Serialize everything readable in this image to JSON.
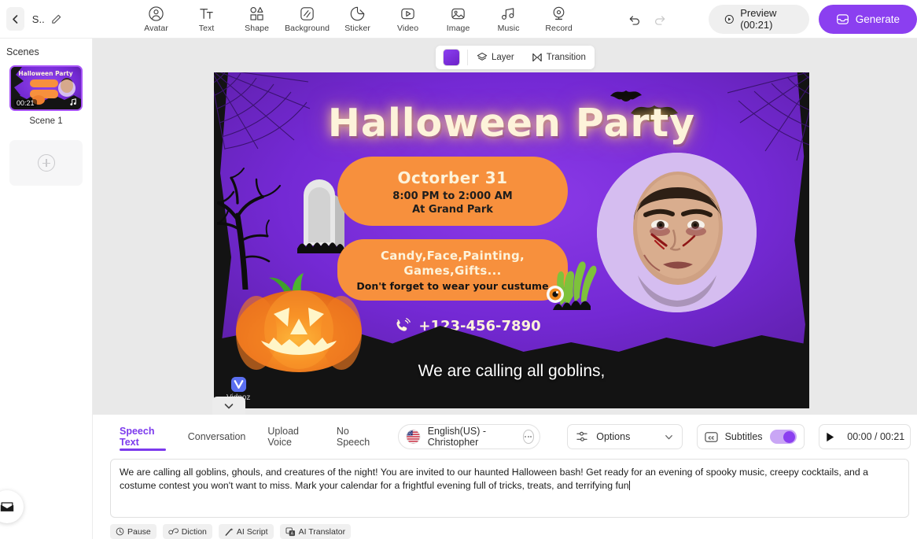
{
  "topbar": {
    "project_title": "S...",
    "back_icon": "chevron-left-icon",
    "edit_icon": "pencil-icon",
    "tools": [
      {
        "label": "Avatar",
        "icon": "avatar-icon"
      },
      {
        "label": "Text",
        "icon": "text-icon"
      },
      {
        "label": "Shape",
        "icon": "shape-icon"
      },
      {
        "label": "Background",
        "icon": "background-icon"
      },
      {
        "label": "Sticker",
        "icon": "sticker-icon"
      },
      {
        "label": "Video",
        "icon": "video-icon"
      },
      {
        "label": "Image",
        "icon": "image-icon"
      },
      {
        "label": "Music",
        "icon": "music-icon"
      },
      {
        "label": "Record",
        "icon": "record-icon"
      }
    ],
    "undo_icon": "undo-icon",
    "redo_icon": "redo-icon",
    "preview_label": "Preview (00:21)",
    "generate_label": "Generate",
    "accent_color": "#8b3ff0"
  },
  "sidebar": {
    "heading": "Scenes",
    "scene": {
      "label": "Scene 1",
      "duration": "00:21",
      "thumb_title": "Halloween Party",
      "music_icon": "music-note-icon"
    },
    "add_scene_icon": "plus-circle-icon",
    "feedback_icon": "envelope-icon"
  },
  "canvas": {
    "layer_bar": {
      "color_swatch": "#7a2fd8",
      "layer_label": "Layer",
      "layer_icon": "layers-icon",
      "transition_label": "Transition",
      "transition_icon": "transition-icon"
    },
    "poster": {
      "title": "Halloween Party",
      "date": "Octorber 31",
      "time_line1": "8:00 PM to 2:000 AM",
      "time_line2": "At Grand Park",
      "features_line1": "Candy,Face,Painting,",
      "features_line2": "Games,Gifts...",
      "note": "Don't forget to wear your custume",
      "phone": "+123-456-7890",
      "phone_icon": "phone-call-icon",
      "watermark": "Vidnoz",
      "watermark_icon": "vidnoz-logo-icon",
      "bg_purple": "#7429d4",
      "accent_orange": "#f7903d",
      "title_cream": "#fdf3da"
    },
    "subtitle_text": "We are calling all goblins,",
    "collapse_icon": "chevron-down-icon"
  },
  "bottom": {
    "tabs": [
      {
        "label": "Speech Text",
        "active": true
      },
      {
        "label": "Conversation",
        "active": false
      },
      {
        "label": "Upload Voice",
        "active": false
      },
      {
        "label": "No Speech",
        "active": false
      }
    ],
    "voice": {
      "flag_icon": "us-flag-icon",
      "name": "English(US) - Christopher",
      "more_icon": "more-options-icon"
    },
    "options": {
      "label": "Options",
      "icon": "sliders-icon",
      "chevron": "chevron-down-icon"
    },
    "subtitles": {
      "label": "Subtitles",
      "icon": "cc-icon",
      "enabled": true,
      "toggle_color": "#8b3ff0"
    },
    "player": {
      "icon": "play-icon",
      "time": "00:00 / 00:21"
    },
    "script": "We are calling all goblins, ghouls, and creatures of the night! You are invited to our haunted Halloween bash! Get ready for an evening of spooky music, creepy cocktails, and a costume contest you won't want to miss. Mark your calendar for a frightful evening full of tricks, treats, and terrifying fun",
    "chips": [
      {
        "label": "Pause",
        "icon": "clock-icon"
      },
      {
        "label": "Diction",
        "icon": "diction-icon"
      },
      {
        "label": "AI Script",
        "icon": "magic-wand-icon"
      },
      {
        "label": "AI Translator",
        "icon": "translate-icon"
      }
    ]
  }
}
